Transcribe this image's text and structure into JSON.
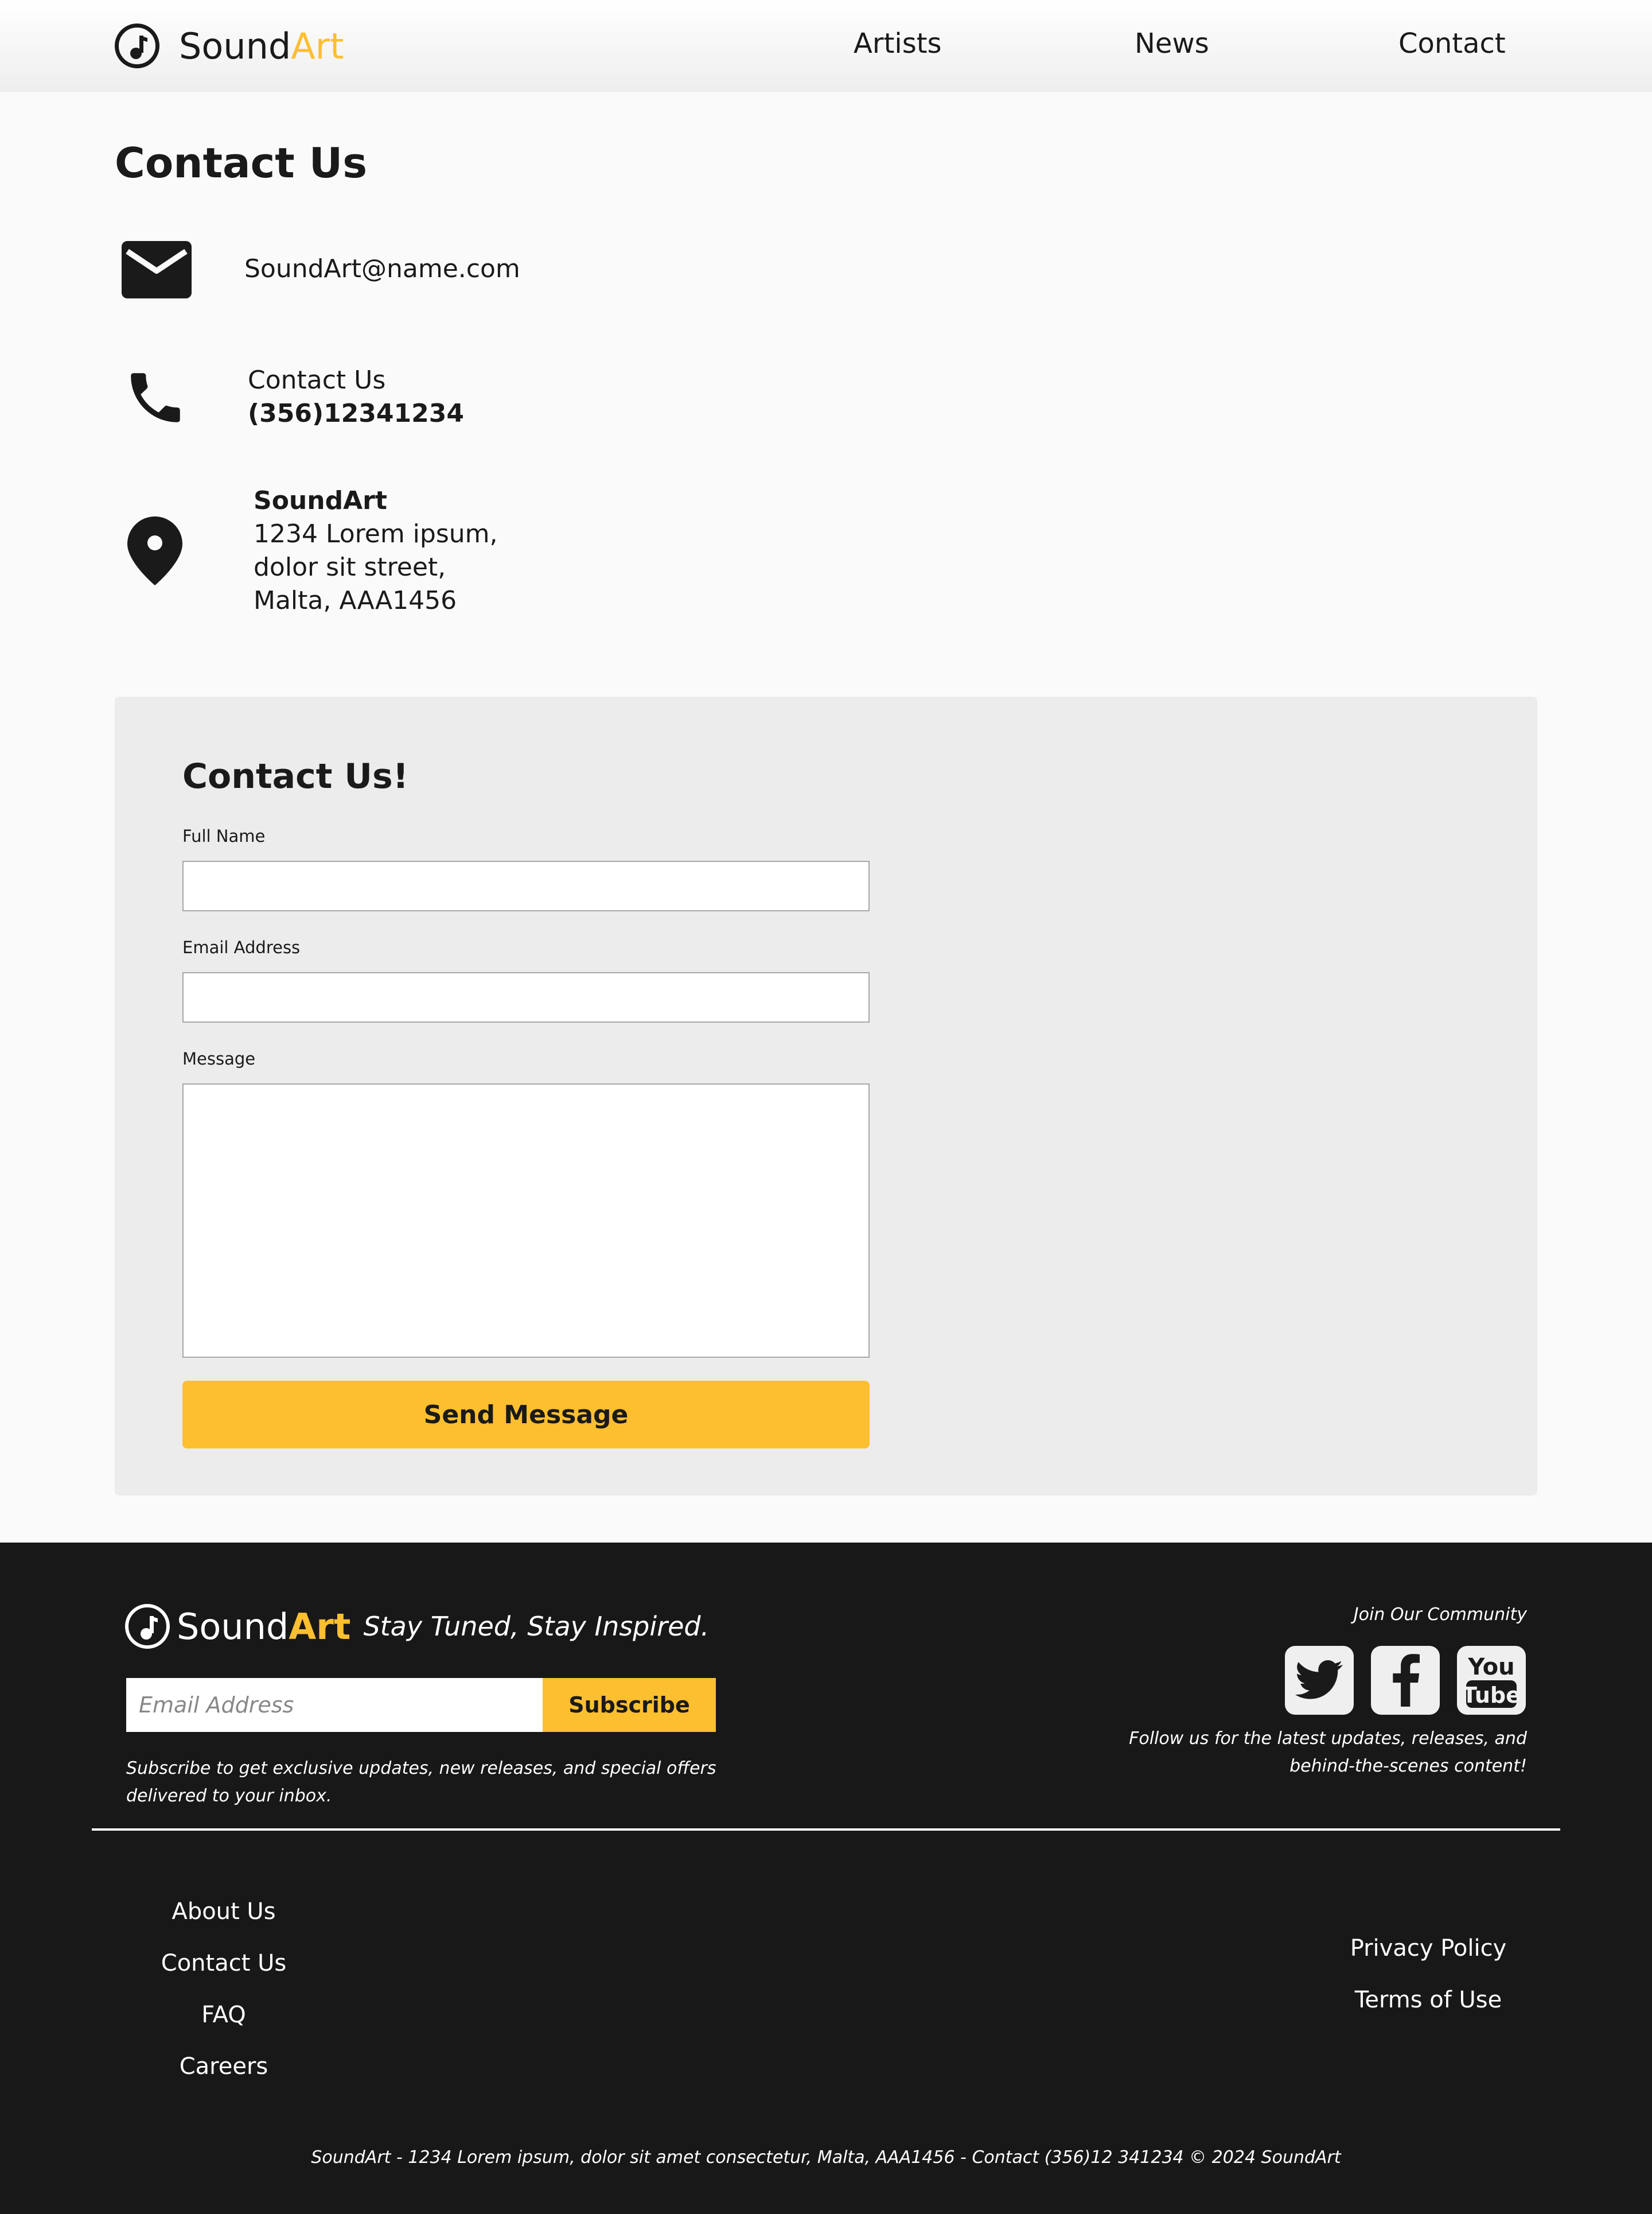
{
  "header": {
    "logo_primary": "Sound",
    "logo_accent": "Art",
    "nav": [
      "Artists",
      "News",
      "Contact"
    ]
  },
  "colors": {
    "accent": "#fcbf30",
    "footer_bg": "#181818",
    "card_bg": "#ececec"
  },
  "contact": {
    "title": "Contact Us",
    "email": "SoundArt@name.com",
    "phone_label": "Contact Us",
    "phone_number": "(356)12341234",
    "address_name": "SoundArt",
    "address_line1": "1234 Lorem ipsum,",
    "address_line2": "dolor sit street,",
    "address_line3": "Malta, AAA1456",
    "icons": [
      "envelope-icon",
      "phone-icon",
      "map-pin-icon"
    ]
  },
  "form": {
    "title": "Contact Us!",
    "full_name_label": "Full Name",
    "full_name_value": "",
    "email_label": "Email Address",
    "email_value": "",
    "message_label": "Message",
    "message_value": "",
    "submit_label": "Send Message"
  },
  "footer": {
    "logo_primary": "Sound",
    "logo_accent": "Art",
    "tagline": "Stay Tuned, Stay Inspired.",
    "subscribe_placeholder": "Email Address",
    "subscribe_button": "Subscribe",
    "subscribe_note": "Subscribe to get exclusive updates, new releases, and special offers delivered to your inbox.",
    "join": "Join Our Community",
    "social": [
      "twitter-icon",
      "facebook-icon",
      "youtube-icon"
    ],
    "follow": "Follow us for the latest updates, releases, and behind-the-scenes content!",
    "links_left": [
      "About Us",
      "Contact Us",
      "FAQ",
      "Careers"
    ],
    "links_right": [
      "Privacy Policy",
      "Terms of Use"
    ],
    "copyright": "SoundArt - 1234 Lorem ipsum, dolor sit amet consectetur, Malta, AAA1456 - Contact (356)12 341234 © 2024 SoundArt"
  }
}
